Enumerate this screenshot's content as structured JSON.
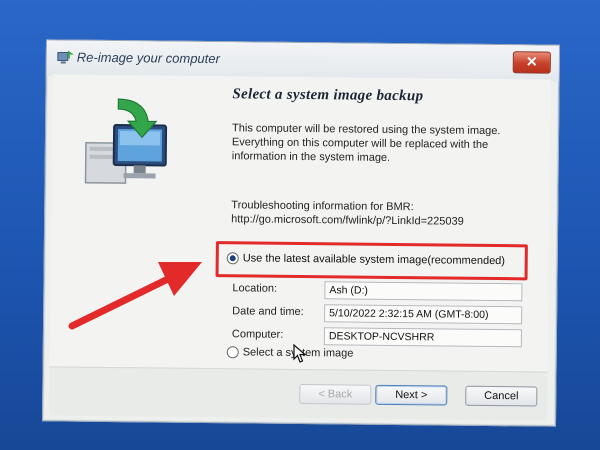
{
  "window": {
    "title": "Re-image your computer",
    "close_label": "✕"
  },
  "main": {
    "heading": "Select a system image backup",
    "description": "This computer will be restored using the system image. Everything on this computer will be replaced with the information in the system image.",
    "troubleshooting_label": "Troubleshooting information for BMR:",
    "troubleshooting_link": "http://go.microsoft.com/fwlink/p/?LinkId=225039"
  },
  "options": {
    "latest_label": "Use the latest available system image(recommended)",
    "latest_selected": true,
    "select_label": "Select a system image",
    "select_selected": false
  },
  "details": {
    "location_label": "Location:",
    "location_value": "Ash (D:)",
    "datetime_label": "Date and time:",
    "datetime_value": "5/10/2022 2:32:15 AM (GMT-8:00)",
    "computer_label": "Computer:",
    "computer_value": "DESKTOP-NCVSHRR"
  },
  "footer": {
    "back_label": "< Back",
    "next_label": "Next >",
    "cancel_label": "Cancel"
  },
  "colors": {
    "annotation_red": "#e22a2a",
    "desktop_blue": "#1e56b3"
  }
}
